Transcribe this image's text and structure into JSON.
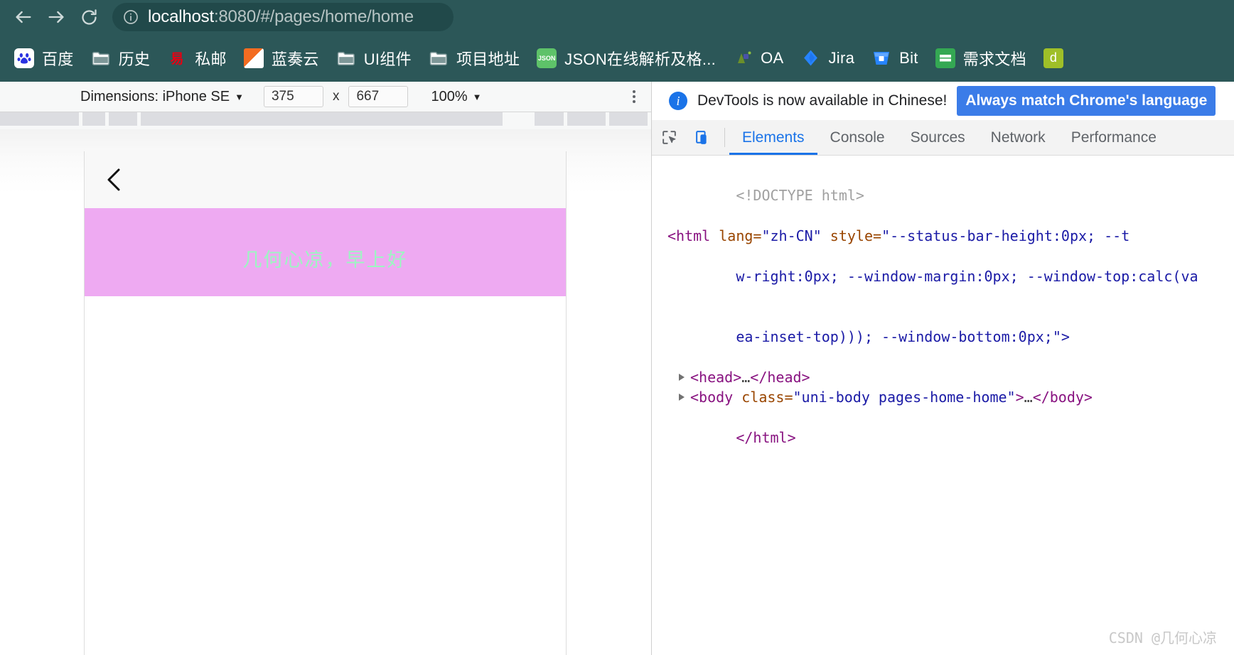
{
  "browser": {
    "nav": {
      "back_label": "Back",
      "forward_label": "Forward",
      "reload_label": "Reload"
    },
    "omnibox": {
      "site_info_icon": "info-circle-icon",
      "host": "localhost",
      "path": ":8080/#/pages/home/home",
      "full_url": "localhost:8080/#/pages/home/home"
    },
    "bookmarks": [
      {
        "label": "百度",
        "icon": "baidu-icon"
      },
      {
        "label": "历史",
        "icon": "folder-icon"
      },
      {
        "label": "私邮",
        "icon": "siyou-icon"
      },
      {
        "label": "蓝奏云",
        "icon": "lanzou-icon"
      },
      {
        "label": "UI组件",
        "icon": "folder-icon"
      },
      {
        "label": "项目地址",
        "icon": "folder-icon"
      },
      {
        "label": "JSON在线解析及格...",
        "icon": "json-icon"
      },
      {
        "label": "OA",
        "icon": "oa-icon"
      },
      {
        "label": "Jira",
        "icon": "jira-icon"
      },
      {
        "label": "Bit",
        "icon": "bitbucket-icon"
      },
      {
        "label": "需求文档",
        "icon": "sheets-icon"
      },
      {
        "label": "",
        "icon": "green-app-icon"
      }
    ]
  },
  "device_toolbar": {
    "dimensions_label": "Dimensions: iPhone SE",
    "width": "375",
    "multiply": "x",
    "height": "667",
    "zoom": "100%",
    "more_label": "More options"
  },
  "phone_preview": {
    "back_label": "返回",
    "greeting": "几何心凉，早上好",
    "banner_color": "#eeaaf2",
    "greeting_color": "#9df5c2"
  },
  "devtools": {
    "banner": {
      "message": "DevTools is now available in Chinese!",
      "action_label": "Always match Chrome's language",
      "icon": "info-icon"
    },
    "toolbar_icons": [
      {
        "name": "inspect-element-icon"
      },
      {
        "name": "device-toolbar-icon"
      }
    ],
    "tabs": [
      {
        "label": "Elements",
        "active": true
      },
      {
        "label": "Console",
        "active": false
      },
      {
        "label": "Sources",
        "active": false
      },
      {
        "label": "Network",
        "active": false
      },
      {
        "label": "Performance",
        "active": false
      }
    ],
    "dom": {
      "line1": "<!DOCTYPE html>",
      "line2_open": "<html",
      "line2_attr1": " lang=",
      "line2_val1": "\"zh-CN\"",
      "line2_attr2": " style=",
      "line2_val2": "\"--status-bar-height:0px; --t",
      "line3": "w-right:0px; --window-margin:0px; --window-top:calc(va",
      "line4": "ea-inset-top))); --window-bottom:0px;\">",
      "line5_tag_open": "<head>",
      "line5_ellipsis": "…",
      "line5_tag_close": "</head>",
      "line6_tag_open": "<body",
      "line6_attr": " class=",
      "line6_val": "\"uni-body pages-home-home\"",
      "line6_gt": ">",
      "line6_ellipsis": "…",
      "line6_tag_close": "</body>",
      "line7": "</html>"
    }
  },
  "watermark": "CSDN @几何心凉"
}
